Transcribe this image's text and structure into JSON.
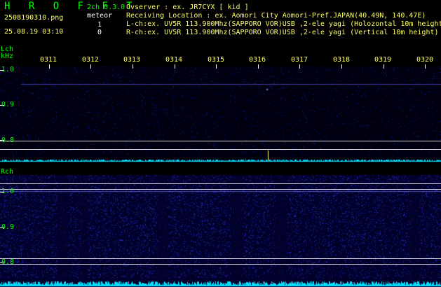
{
  "header": {
    "app_name": "H R O F F T",
    "channels_version": "2ch 0.3.0",
    "filename": "2508190310.png",
    "meteor_label": "meteor",
    "datetime": "25.08.19 03:10",
    "l_count": "1",
    "r_count": "0",
    "observer_line": "Ovserver              : ex. JR7CYX [ kid ]",
    "location_line": "Receiving Location : ex. Aomori City Aomori-Pref.JAPAN(40.49N, 140.47E)",
    "lch_info": "L-ch:ex. UV5R 113.900Mhz(SAPPORO VOR)USB ,2-ele yagi (Holozontal 10m height)",
    "rch_info": "R-ch:ex. UV5R 113.900Mhz(SAPPORO VOR)USB ,2-ele yagi (Vertical 10m height)"
  },
  "axis": {
    "lch_label": "Lch",
    "unit_label": "kHz",
    "rch_label": "Rch",
    "minute_ticks": [
      "0311",
      "0312",
      "0313",
      "0314",
      "0315",
      "0316",
      "0317",
      "0318",
      "0319",
      "0320"
    ],
    "freq_ticks": [
      "1.0",
      "0.9",
      "0.8"
    ]
  },
  "colors": {
    "accent_green": "#00ff00",
    "header_yellow": "#ffff60",
    "noise_blue": "#2a2aff",
    "trace_cyan": "#00e0ff"
  }
}
